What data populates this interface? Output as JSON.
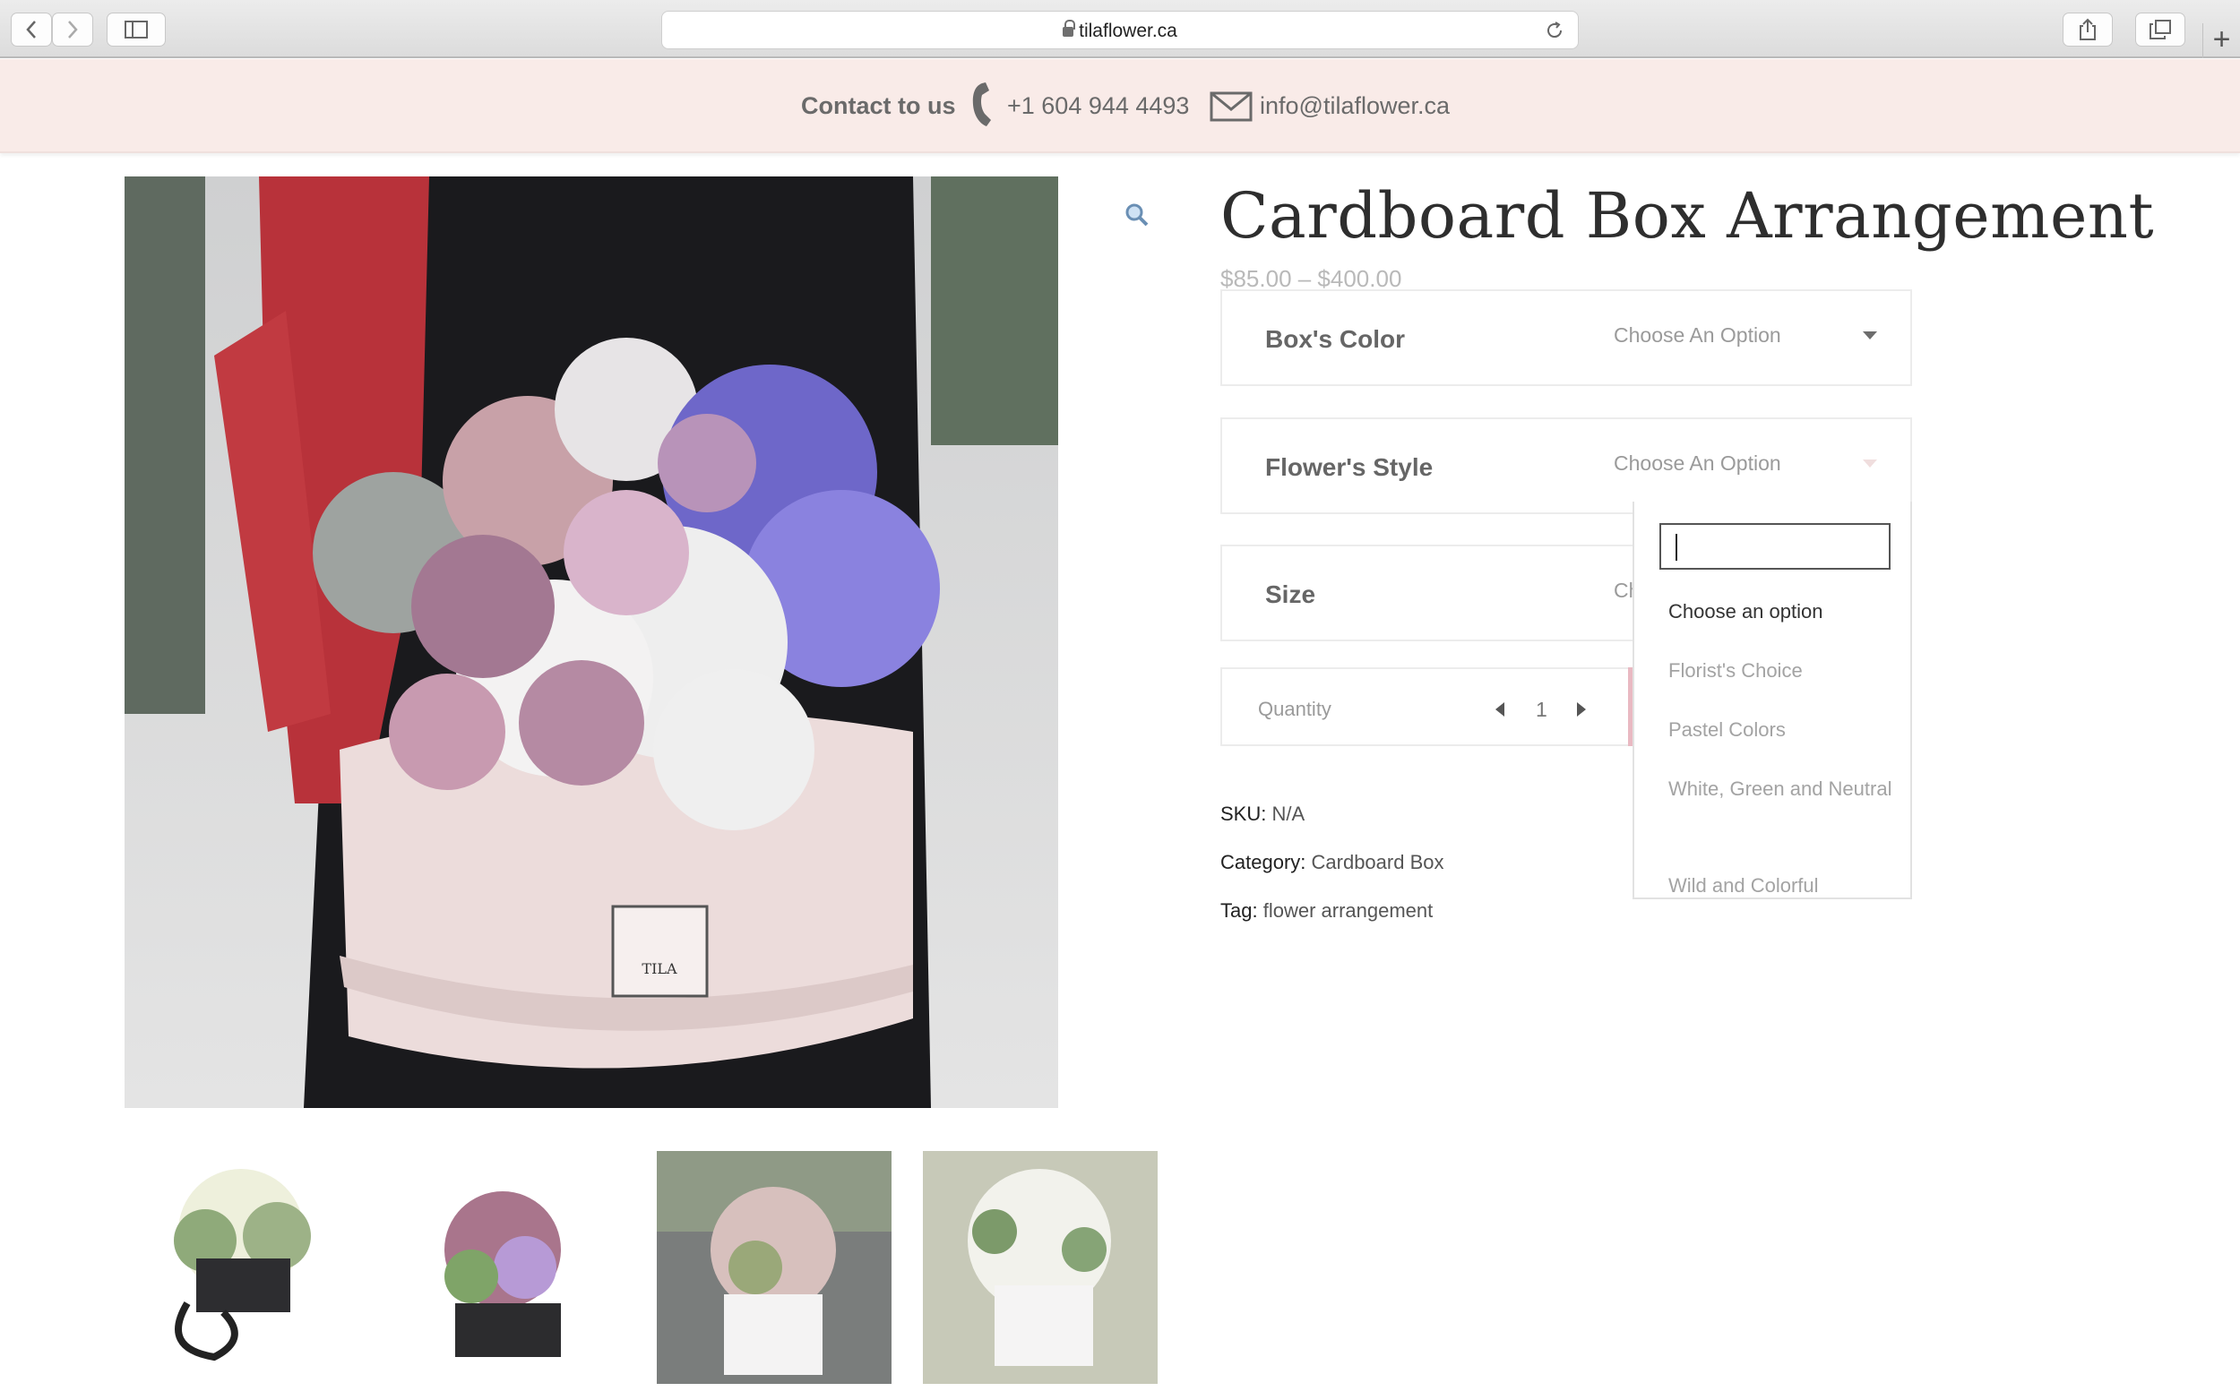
{
  "browser": {
    "url": "tilaflower.ca"
  },
  "contact_bar": {
    "label": "Contact to us",
    "phone": "+1 604 944 4493",
    "email": "info@tilaflower.ca"
  },
  "product": {
    "title": "Cardboard Box Arrangement",
    "price": "$85.00 – $400.00",
    "options": [
      {
        "name": "Box's Color",
        "value": "Choose An Option"
      },
      {
        "name": "Flower's Style",
        "value": "Choose An Option"
      },
      {
        "name": "Size",
        "value": "Ch"
      }
    ],
    "quantity": {
      "label": "Quantity",
      "value": "1"
    },
    "sku": {
      "label": "SKU:",
      "value": "N/A"
    },
    "category": {
      "label": "Category:",
      "value": "Cardboard Box"
    },
    "tag": {
      "label": "Tag:",
      "value": "flower arrangement"
    }
  },
  "dropdown": {
    "search_value": "",
    "items": [
      "Choose an option",
      "Florist's Choice",
      "Pastel Colors",
      "White, Green and Neutral",
      "Wild and Colorful"
    ]
  },
  "icons": {
    "back": "chevron-left-icon",
    "forward": "chevron-right-icon",
    "sidebar": "sidebar-icon",
    "share": "share-icon",
    "tabs": "tabs-icon",
    "new_tab": "plus-icon",
    "reload": "reload-icon",
    "lock": "lock-icon",
    "phone": "phone-icon",
    "mail": "mail-icon",
    "zoom": "magnifier-icon"
  },
  "colors": {
    "contact_bar_bg": "#f9ebe8",
    "accent_pink": "#e9b9c2",
    "title_text": "#2e2e2e"
  }
}
